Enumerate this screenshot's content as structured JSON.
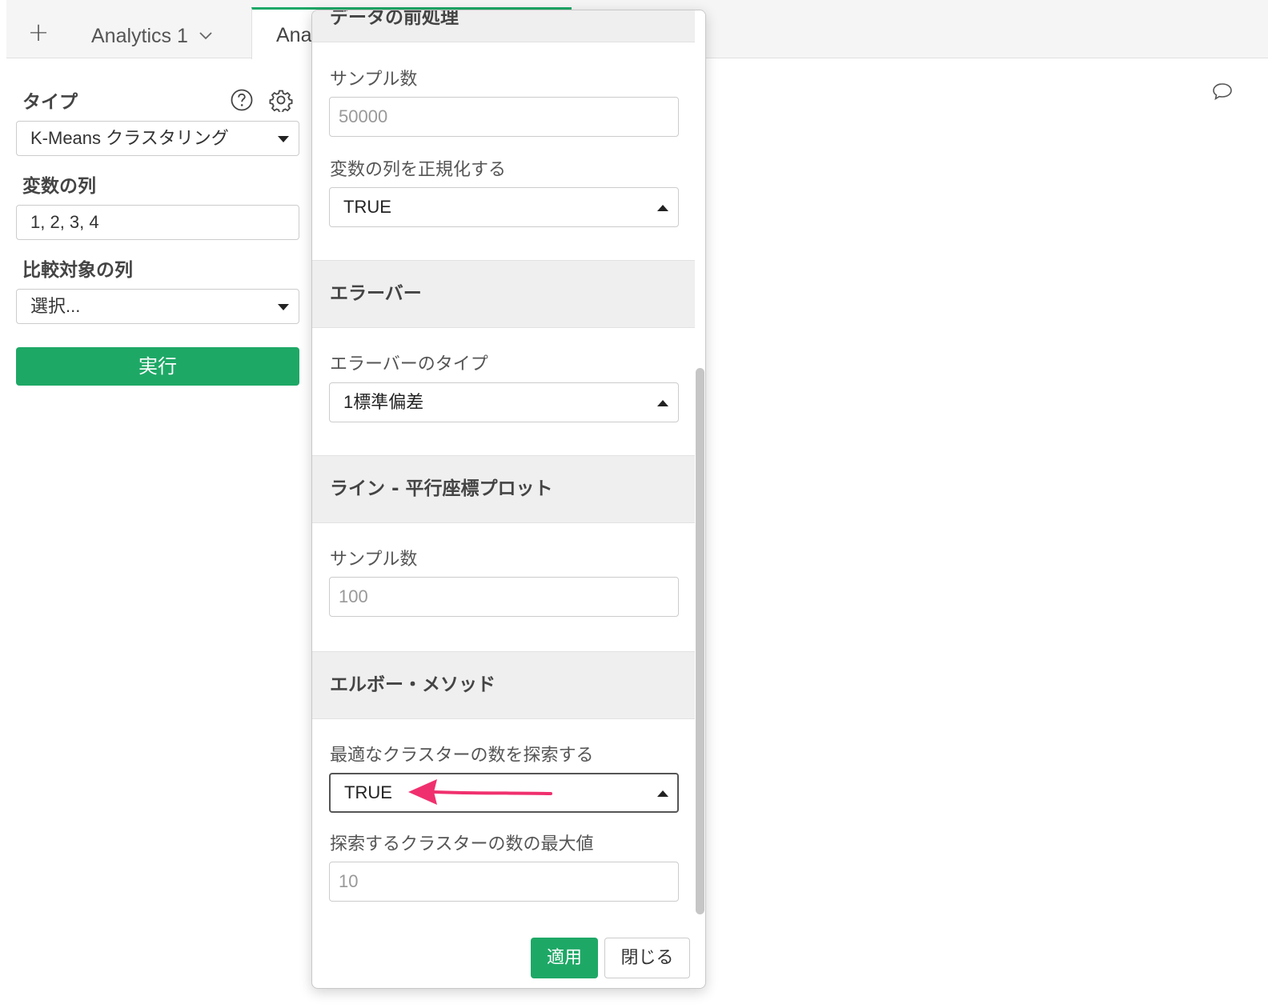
{
  "tabs": {
    "add_icon": "+",
    "tab1_label": "Analytics 1",
    "tab1_chevron": "chevron-down-icon",
    "tab2_label": "Analy"
  },
  "left_panel": {
    "type_label": "タイプ",
    "type_value": "K-Means クラスタリング",
    "variables_label": "変数の列",
    "variables_value": "1, 2, 3, 4",
    "compare_label": "比較対象の列",
    "compare_value": "選択...",
    "run_label": "実行",
    "icons": [
      "help-icon",
      "gear-icon"
    ]
  },
  "modal": {
    "top_section_title": "データの前処理",
    "sample_label": "サンプル数",
    "sample_placeholder": "50000",
    "normalize_label": "変数の列を正規化する",
    "normalize_value": "TRUE",
    "errorbar_section": "エラーバー",
    "errorbar_type_label": "エラーバーのタイプ",
    "errorbar_type_value": "1標準偏差",
    "line_section": "ライン - 平行座標プロット",
    "line_sample_label": "サンプル数",
    "line_sample_placeholder": "100",
    "elbow_section": "エルボー・メソッド",
    "elbow_search_label": "最適なクラスターの数を探索する",
    "elbow_search_value": "TRUE",
    "elbow_max_label": "探索するクラスターの数の最大値",
    "elbow_max_placeholder": "10",
    "apply_label": "適用",
    "close_label": "閉じる"
  },
  "colors": {
    "accent": "#1ea866",
    "annotation_arrow": "#f0306e"
  }
}
